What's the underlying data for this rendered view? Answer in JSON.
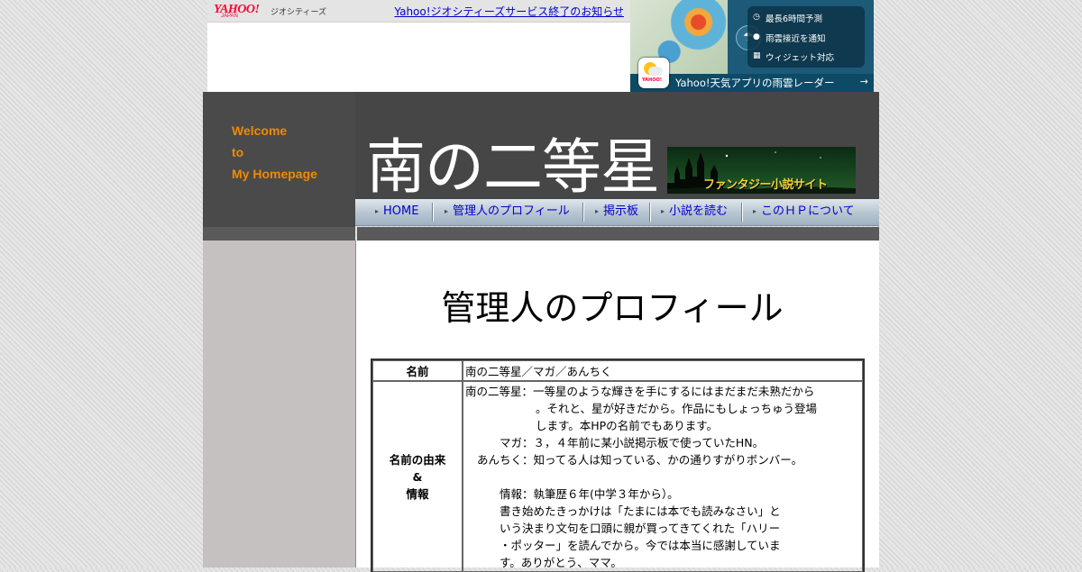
{
  "yahoo_bar": {
    "logo": "YAHOO!",
    "logo_sub": "JAPAN",
    "service": "ジオシティーズ",
    "notice_link": "Yahoo!ジオシティーズサービス終了のお知らせ"
  },
  "ad": {
    "features": [
      "最長6時間予測",
      "雨雲接近を通知",
      "ウィジェット対応"
    ],
    "app_icon_label": "YAHOO!",
    "bottom_text": "Yahoo!天気アプリの雨雲レーダー",
    "arrow": "→"
  },
  "header": {
    "welcome_lines": [
      "Welcome",
      "to",
      "My Homepage"
    ],
    "site_title": "南の二等星",
    "banner_text": "ファンタジー小説サイト"
  },
  "nav": {
    "items": [
      "HOME",
      "管理人のプロフィール",
      "掲示板",
      "小説を読む",
      "このＨＰについて"
    ]
  },
  "page": {
    "heading": "管理人のプロフィール"
  },
  "profile": {
    "row1": {
      "label": "名前",
      "value": "南の二等星／マガ／あんちく"
    },
    "row2": {
      "label_lines": [
        "名前の由来",
        "&",
        "情報"
      ],
      "lines": [
        "南の二等星：一等星のような輝きを手にするにはまだまだ未熟だから",
        "。それと、星が好きだから。作品にもしょっちゅう登場",
        "します。本HPの名前でもあります。",
        "マガ：３，４年前に某小説掲示板で使っていたHN。",
        "あんちく：知ってる人は知っている、かの通りすがりボンバー。",
        "情報：執筆歴６年(中学３年から）。",
        "書き始めたきっかけは「たまには本でも読みなさい」と",
        "いう決まり文句を口頭に親が買ってきてくれた「ハリー",
        "・ポッター」を読んでから。今では本当に感謝していま",
        "す。ありがとう、ママ。"
      ]
    }
  }
}
